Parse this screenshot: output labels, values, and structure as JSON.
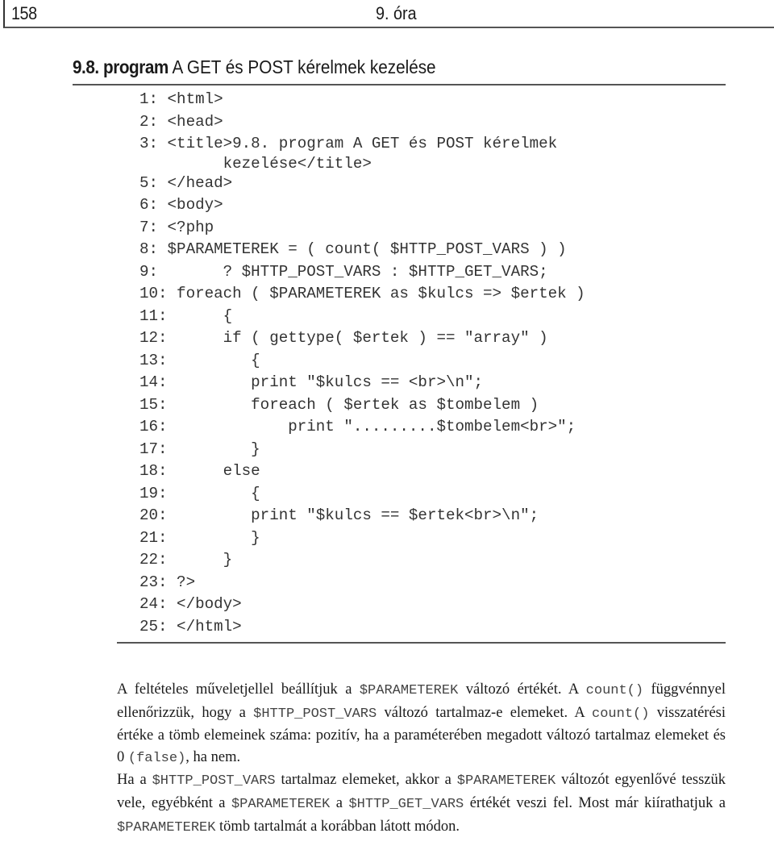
{
  "header": {
    "page_number": "158",
    "chapter": "9. óra"
  },
  "listing": {
    "number": "9.8. program",
    "title": "A GET és POST kérelmek kezelése"
  },
  "code_lines": [
    "1: <html>",
    "2: <head>",
    "3: <title>9.8. program A GET és POST kérelmek",
    "         kezelése</title>",
    "5: </head>",
    "6: <body>",
    "7: <?php",
    "8: $PARAMETEREK = ( count( $HTTP_POST_VARS ) )",
    "9:       ? $HTTP_POST_VARS : $HTTP_GET_VARS;",
    "10: foreach ( $PARAMETEREK as $kulcs => $ertek )",
    "11:      {",
    "12:      if ( gettype( $ertek ) == \"array\" )",
    "13:         {",
    "14:         print \"$kulcs == <br>\\n\";",
    "15:         foreach ( $ertek as $tombelem )",
    "16:             print \".........$tombelem<br>\";",
    "17:         }",
    "18:      else",
    "19:         {",
    "20:         print \"$kulcs == $ertek<br>\\n\";",
    "21:         }",
    "22:      }",
    "23: ?>",
    "24: </body>",
    "25: </html>"
  ],
  "explanation": {
    "p1": {
      "t1": "A feltételes műveletjellel beállítjuk a ",
      "c1": "$PARAMETEREK",
      "t2": " változó értékét. A ",
      "c2": "count()",
      "t3": " függvénnyel ellenőrizzük, hogy a ",
      "c3": "$HTTP_POST_VARS",
      "t4": " változó tartalmaz-e elemeket. A ",
      "c4": "count()",
      "t5": " visszatérési értéke a tömb elemeinek száma: pozitív, ha a paraméterében megadott változó tartalmaz elemeket és 0 ",
      "c5": "(false)",
      "t6": ", ha nem."
    },
    "p2": {
      "t1": "Ha a ",
      "c1": "$HTTP_POST_VARS",
      "t2": " tartalmaz elemeket, akkor a ",
      "c2": "$PARAMETEREK",
      "t3": " változót egyenlővé tesszük vele, egyébként a ",
      "c3": "$PARAMETEREK",
      "t4": " a ",
      "c4": "$HTTP_GET_VARS",
      "t5": " értékét veszi fel. Most már kiírathatjuk a ",
      "c5": "$PARAMETEREK",
      "t6": " tömb tartalmát a korábban látott módon."
    }
  }
}
